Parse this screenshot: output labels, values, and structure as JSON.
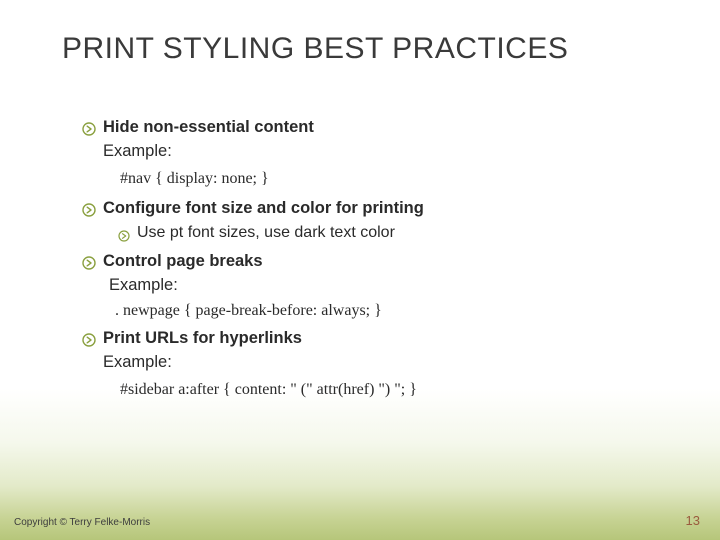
{
  "title": "PRINT STYLING BEST PRACTICES",
  "bullets": {
    "b1": {
      "heading": "Hide non-essential content",
      "example_label": "Example:",
      "code": "#nav { display: none; }"
    },
    "b2": {
      "heading": "Configure font size and color for printing",
      "sub": "Use pt font sizes, use dark text color"
    },
    "b3": {
      "heading": "Control page breaks",
      "example_label": "Example:",
      "code": ". newpage { page-break-before: always; }"
    },
    "b4": {
      "heading": "Print URLs for hyperlinks",
      "example_label": "Example:",
      "code": "#sidebar a:after { content: \" (\" attr(href) \") \"; }"
    }
  },
  "footer": "Copyright © Terry Felke-Morris",
  "page_number": "13"
}
